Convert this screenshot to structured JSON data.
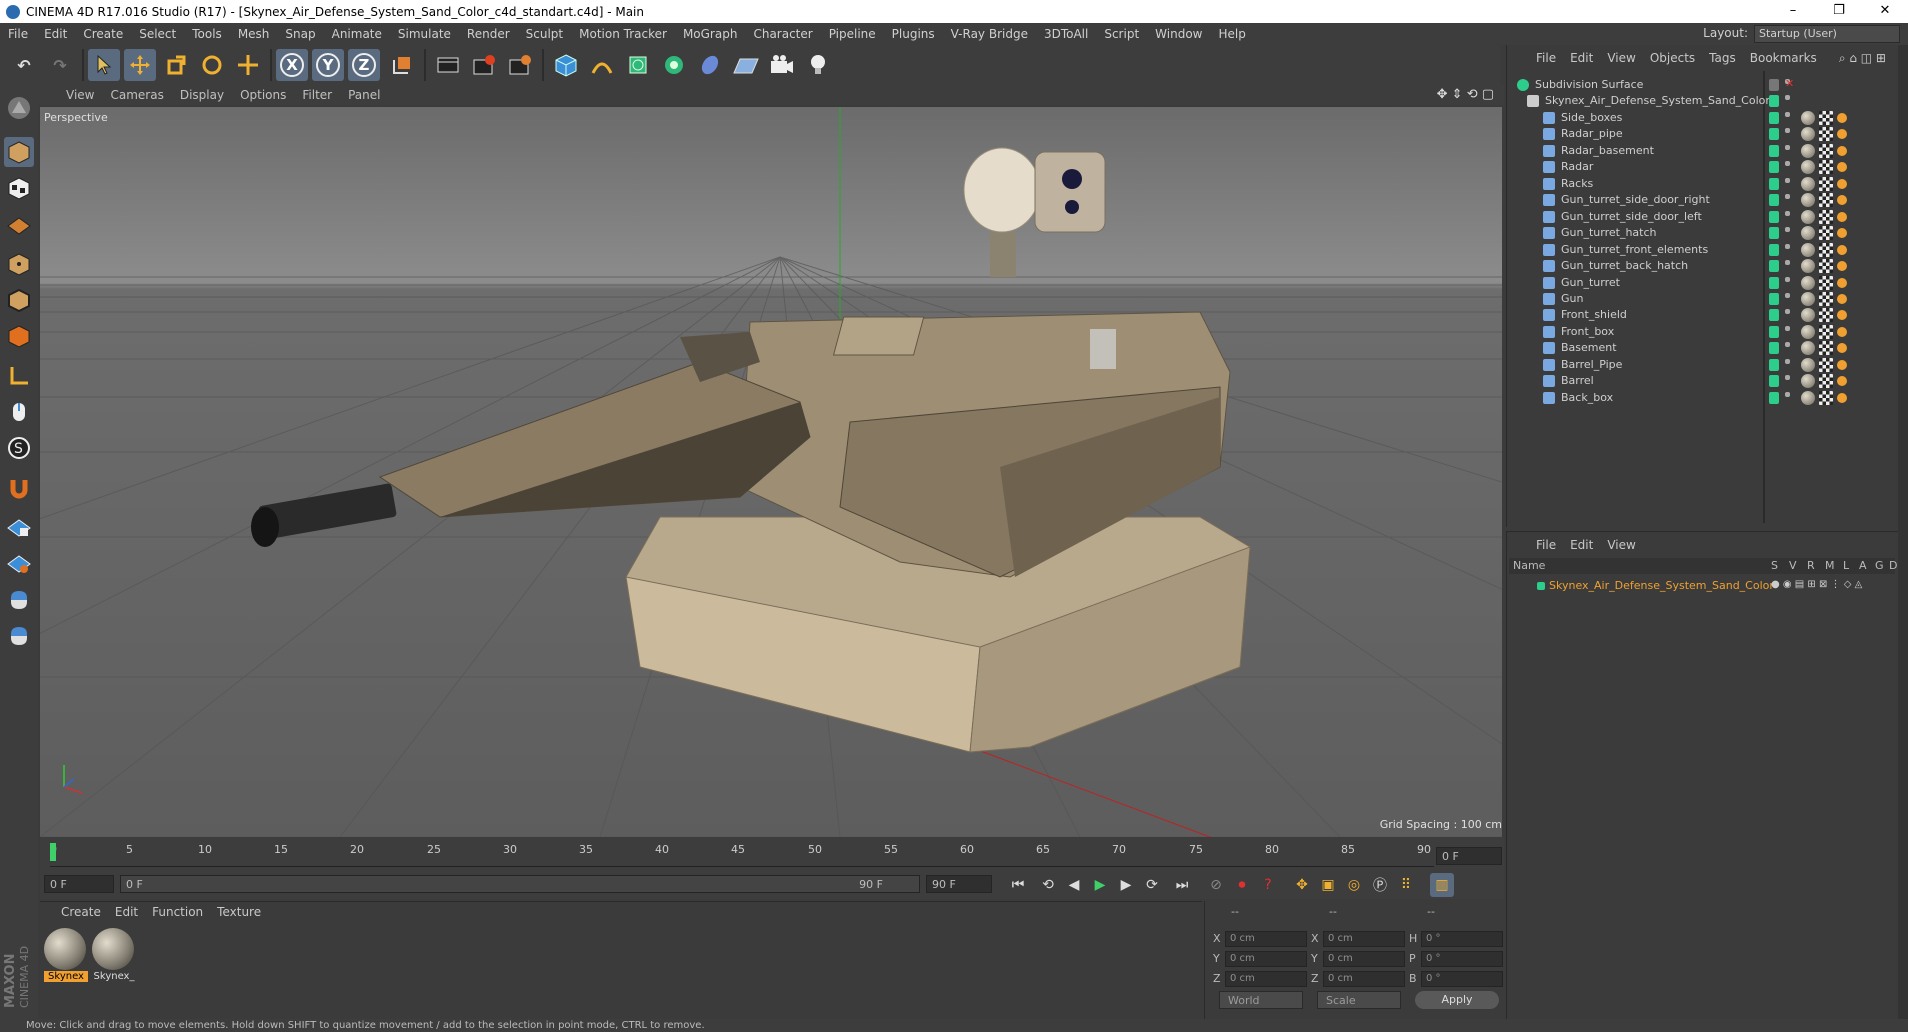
{
  "window": {
    "title": "CINEMA 4D R17.016 Studio (R17) - [Skynex_Air_Defense_System_Sand_Color_c4d_standart.c4d] - Main",
    "minimize": "–",
    "restore": "❐",
    "close": "✕"
  },
  "menubar": {
    "items": [
      "File",
      "Edit",
      "Create",
      "Select",
      "Tools",
      "Mesh",
      "Snap",
      "Animate",
      "Simulate",
      "Render",
      "Sculpt",
      "Motion Tracker",
      "MoGraph",
      "Character",
      "Pipeline",
      "Plugins",
      "V-Ray Bridge",
      "3DToAll",
      "Script",
      "Window",
      "Help"
    ],
    "layout_label": "Layout:",
    "layout_value": "Startup (User)"
  },
  "viewport": {
    "menu": [
      "View",
      "Cameras",
      "Display",
      "Options",
      "Filter",
      "Panel"
    ],
    "camera_label": "Perspective",
    "grid_spacing": "Grid Spacing : 100 cm"
  },
  "timeline": {
    "ticks": [
      "0",
      "5",
      "10",
      "15",
      "20",
      "25",
      "30",
      "35",
      "40",
      "45",
      "50",
      "55",
      "60",
      "65",
      "70",
      "75",
      "80",
      "85",
      "90"
    ],
    "current_frame": "0 F",
    "start_field": "0 F",
    "slider_start": "0 F",
    "slider_end": "90 F",
    "end_field": "90 F"
  },
  "materials": {
    "menu": [
      "Create",
      "Edit",
      "Function",
      "Texture"
    ],
    "items": [
      {
        "label": "Skynex",
        "selected": true
      },
      {
        "label": "Skynex_",
        "selected": false
      }
    ]
  },
  "coordinates": {
    "headers": [
      "--",
      "--",
      "--"
    ],
    "rows": [
      {
        "l1": "X",
        "v1": "0 cm",
        "l2": "X",
        "v2": "0 cm",
        "l3": "H",
        "v3": "0 °"
      },
      {
        "l1": "Y",
        "v1": "0 cm",
        "l2": "Y",
        "v2": "0 cm",
        "l3": "P",
        "v3": "0 °"
      },
      {
        "l1": "Z",
        "v1": "0 cm",
        "l2": "Z",
        "v2": "0 cm",
        "l3": "B",
        "v3": "0 °"
      }
    ],
    "space": "World",
    "mode": "Scale",
    "apply": "Apply"
  },
  "object_manager": {
    "menu": [
      "File",
      "Edit",
      "View",
      "Objects",
      "Tags",
      "Bookmarks"
    ],
    "root": "Subdivision Surface",
    "group": "Skynex_Air_Defense_System_Sand_Color",
    "children": [
      "Side_boxes",
      "Radar_pipe",
      "Radar_basement",
      "Radar",
      "Racks",
      "Gun_turret_side_door_right",
      "Gun_turret_side_door_left",
      "Gun_turret_hatch",
      "Gun_turret_front_elements",
      "Gun_turret_back_hatch",
      "Gun_turret",
      "Gun",
      "Front_shield",
      "Front_box",
      "Basement",
      "Barrel_Pipe",
      "Barrel",
      "Back_box"
    ]
  },
  "attributes": {
    "menu": [
      "File",
      "Edit",
      "View"
    ],
    "columns": [
      "Name",
      "S",
      "V",
      "R",
      "M",
      "L",
      "A",
      "G",
      "D"
    ],
    "layer_name": "Skynex_Air_Defense_System_Sand_Color"
  },
  "status": {
    "text": "Move: Click and drag to move elements. Hold down SHIFT to quantize movement / add to the selection in point mode, CTRL to remove."
  },
  "colors": {
    "accent_select": "#5a6b80",
    "layer_green": "#2dce8c",
    "layer_orange": "#f0a030"
  }
}
